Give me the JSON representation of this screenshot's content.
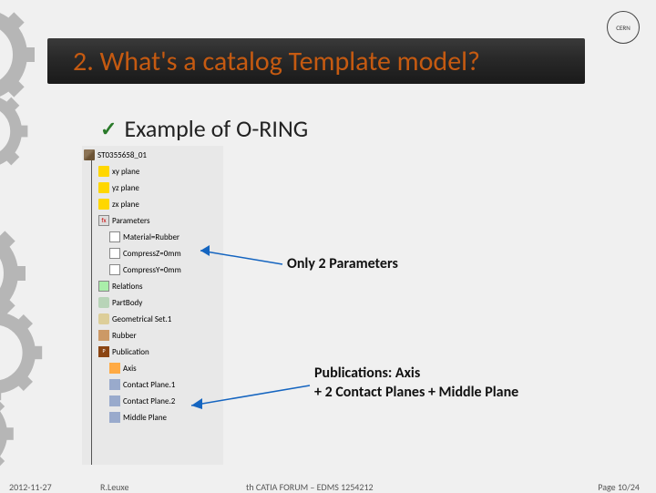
{
  "logo": "CERN",
  "title": "2.  What's a catalog Template model?",
  "bullet": "Example of O-RING",
  "tree": {
    "root": "ST0355658_01",
    "planes": [
      "xy plane",
      "yz plane",
      "zx plane"
    ],
    "params_label": "Parameters",
    "params": [
      "Material=Rubber",
      "CompressZ=0mm",
      "CompressY=0mm"
    ],
    "relations": "Relations",
    "partbody": "PartBody",
    "geoset": "Geometrical Set.1",
    "rubber": "Rubber",
    "publication": "Publication",
    "pubs": [
      "Axis",
      "Contact Plane.1",
      "Contact Plane.2",
      "Middle Plane"
    ]
  },
  "annotations": {
    "params": "Only 2 Parameters",
    "pubs_line1": "Publications: Axis",
    "pubs_line2": "+ 2 Contact Planes + Middle Plane"
  },
  "footer": {
    "date": "2012-11-27",
    "author": "R.Leuxe",
    "center": "th CATIA FORUM – EDMS 1254212",
    "page": "Page 10/24"
  }
}
